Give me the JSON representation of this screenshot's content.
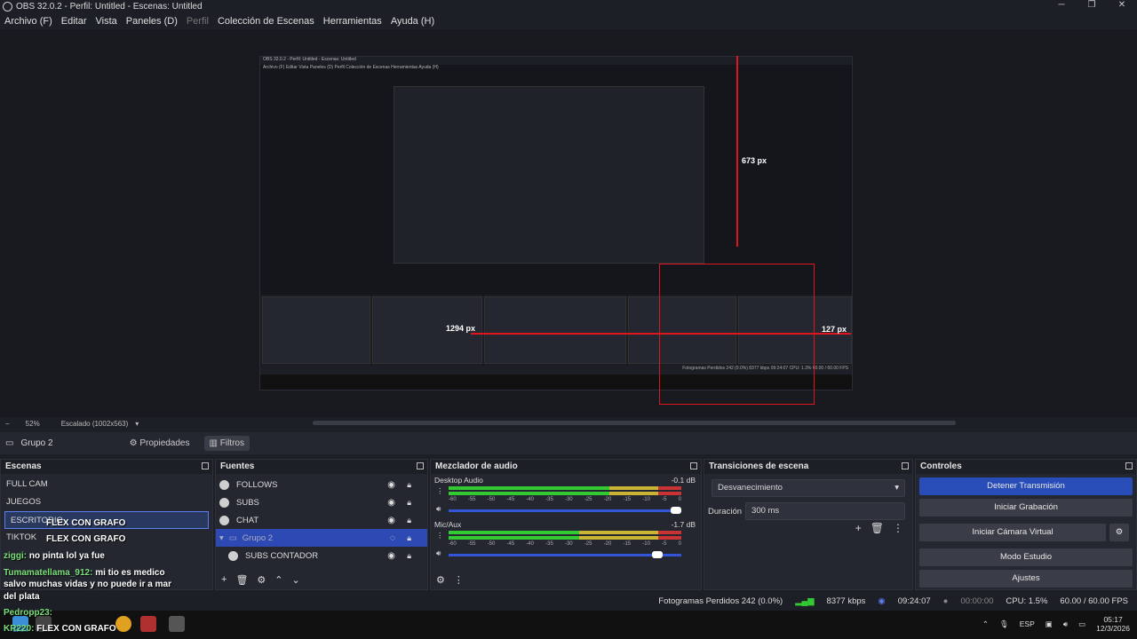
{
  "window": {
    "title": "OBS 32.0.2 - Perfil: Untitled - Escenas: Untitled",
    "controls": [
      "─",
      "❐",
      "✕"
    ]
  },
  "menu": [
    "Archivo (F)",
    "Editar",
    "Vista",
    "Paneles (D)",
    "Perfil",
    "Colección de Escenas",
    "Herramientas",
    "Ayuda (H)"
  ],
  "nested": {
    "title": "OBS 32.0.2 - Perfil: Untitled - Escenas: Untitled",
    "menu": "Archivo (F)  Editar  Vista  Paneles (D)  Perfil  Colección de Escenas  Herramientas  Ayuda (H)",
    "status": "Fotogramas Perdidos 242 (0.0%)   8377 kbps   09:24:07   CPU: 1.3%   60.00 / 60.00 FPS"
  },
  "measurements": {
    "vertical": "673 px",
    "horizontal": "1294 px",
    "right": "127 px"
  },
  "zoom": {
    "percent": "52%",
    "scale": "Escalado (1002x563)"
  },
  "source_bar": {
    "name": "Grupo 2",
    "properties": "Propiedades",
    "filters": "Filtros"
  },
  "scenes": {
    "title": "Escenas",
    "items": [
      "FULL CAM",
      "JUEGOS",
      "ESCRITORIO",
      "TIKTOK"
    ],
    "selected": 2
  },
  "sources": {
    "title": "Fuentes",
    "items": [
      {
        "label": "FOLLOWS"
      },
      {
        "label": "SUBS"
      },
      {
        "label": "CHAT"
      },
      {
        "label": "Grupo 2"
      },
      {
        "label": "SUBS CONTADOR"
      }
    ]
  },
  "mixer": {
    "title": "Mezclador de audio",
    "channels": [
      {
        "name": "Desktop Audio",
        "db": "-0.1 dB",
        "green": 0.69,
        "yellow": 0.9,
        "vol": 1.0
      },
      {
        "name": "Mic/Aux",
        "db": "-1.7 dB",
        "green": 0.56,
        "yellow": 0.9,
        "vol": 0.92
      }
    ],
    "ticks": [
      "-60",
      "-55",
      "-50",
      "-45",
      "-40",
      "-35",
      "-30",
      "-25",
      "-20",
      "-15",
      "-10",
      "-5",
      "0"
    ]
  },
  "transitions": {
    "title": "Transiciones de escena",
    "type": "Desvanecimiento",
    "duration_label": "Duración",
    "duration": "300 ms"
  },
  "controls": {
    "title": "Controles",
    "buttons": [
      "Detener Transmisión",
      "Iniciar Grabación",
      "Iniciar Cámara Virtual",
      "Modo Estudio",
      "Ajustes"
    ]
  },
  "status": {
    "dropped": "Fotogramas Perdidos 242 (0.0%)",
    "bitrate": "8377 kbps",
    "stream_time": "09:24:07",
    "rec_time": "00:00:00",
    "cpu": "CPU: 1.5%",
    "fps": "60.00 / 60.00 FPS"
  },
  "chat": [
    {
      "name": "",
      "msg": "FLEX CON GRAFO"
    },
    {
      "name": "",
      "msg": "FLEX CON GRAFO"
    },
    {
      "name": "ziggi:",
      "msg": "no pinta lol ya fue"
    },
    {
      "name": "Tumamatellama_912:",
      "msg": "mi tio es medico"
    },
    {
      "name": "",
      "msg": "salvo muchas vidas y no puede ir a mar"
    },
    {
      "name": "",
      "msg": "del plata"
    },
    {
      "name": "Pedropp23:",
      "msg": ""
    },
    {
      "name": "KR220:",
      "msg": "FLEX CON GRAFO"
    }
  ],
  "tray": {
    "lang": "ESP",
    "time": "05:17",
    "date": "12/3/2026"
  }
}
